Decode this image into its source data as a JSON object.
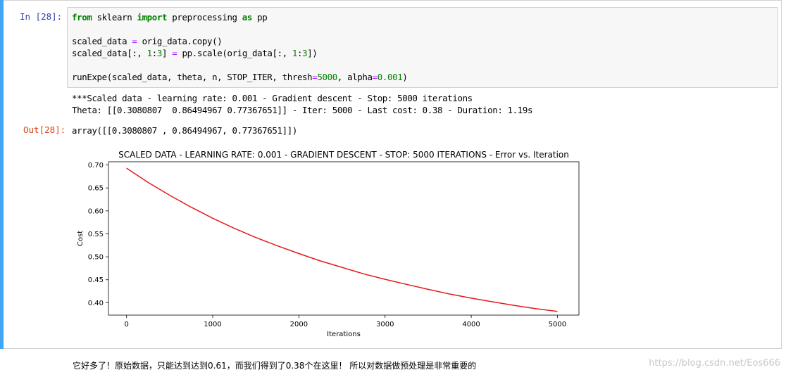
{
  "cell": {
    "in_prompt": "In  [28]:",
    "out_prompt": "Out[28]:",
    "code_lines": [
      [
        {
          "t": "from",
          "c": "kw"
        },
        {
          "t": " sklearn "
        },
        {
          "t": "import",
          "c": "kw"
        },
        {
          "t": " preprocessing "
        },
        {
          "t": "as",
          "c": "kw"
        },
        {
          "t": " pp"
        }
      ],
      [],
      [
        {
          "t": "scaled_data "
        },
        {
          "t": "=",
          "c": "op"
        },
        {
          "t": " orig_data.copy()"
        }
      ],
      [
        {
          "t": "scaled_data[:, "
        },
        {
          "t": "1",
          "c": "num"
        },
        {
          "t": ":"
        },
        {
          "t": "3",
          "c": "num"
        },
        {
          "t": "] "
        },
        {
          "t": "=",
          "c": "op"
        },
        {
          "t": " pp.scale(orig_data[:, "
        },
        {
          "t": "1",
          "c": "num"
        },
        {
          "t": ":"
        },
        {
          "t": "3",
          "c": "num"
        },
        {
          "t": "])"
        }
      ],
      [],
      [
        {
          "t": "runExpe(scaled_data, theta, n, STOP_ITER, thresh"
        },
        {
          "t": "=",
          "c": "op"
        },
        {
          "t": "5000",
          "c": "num"
        },
        {
          "t": ", alpha"
        },
        {
          "t": "=",
          "c": "op"
        },
        {
          "t": "0.001",
          "c": "num"
        },
        {
          "t": ")"
        }
      ]
    ],
    "stream_lines": [
      "***Scaled data - learning rate: 0.001 - Gradient descent - Stop: 5000 iterations",
      "Theta: [[0.3080807  0.86494967 0.77367651]] - Iter: 5000 - Last cost: 0.38 - Duration: 1.19s"
    ],
    "output_text": "array([[0.3080807 , 0.86494967, 0.77367651]])"
  },
  "chart_data": {
    "type": "line",
    "title": "SCALED DATA - LEARNING RATE: 0.001 - GRADIENT DESCENT - STOP: 5000 ITERATIONS - Error vs. Iteration",
    "xlabel": "Iterations",
    "ylabel": "Cost",
    "xlim": [
      -210,
      5250
    ],
    "ylim": [
      0.373,
      0.707
    ],
    "xticks": [
      0,
      1000,
      2000,
      3000,
      4000,
      5000
    ],
    "yticks": [
      0.4,
      0.45,
      0.5,
      0.55,
      0.6,
      0.65,
      0.7
    ],
    "grid": false,
    "series": [
      {
        "color": "#e41a1c",
        "x": [
          0,
          250,
          500,
          750,
          1000,
          1250,
          1500,
          1750,
          2000,
          2250,
          2500,
          2750,
          3000,
          3250,
          3500,
          3750,
          4000,
          4250,
          4500,
          4750,
          5000
        ],
        "y": [
          0.693,
          0.662,
          0.634,
          0.608,
          0.584,
          0.562,
          0.542,
          0.524,
          0.507,
          0.491,
          0.477,
          0.463,
          0.451,
          0.44,
          0.429,
          0.419,
          0.41,
          0.402,
          0.394,
          0.387,
          0.381
        ]
      }
    ]
  },
  "footer": {
    "caption": "它好多了！原始数据，只能达到达到0.61，而我们得到了0.38个在这里！ 所以对数据做预处理是非常重要的",
    "watermark": "https://blog.csdn.net/Eos666"
  }
}
